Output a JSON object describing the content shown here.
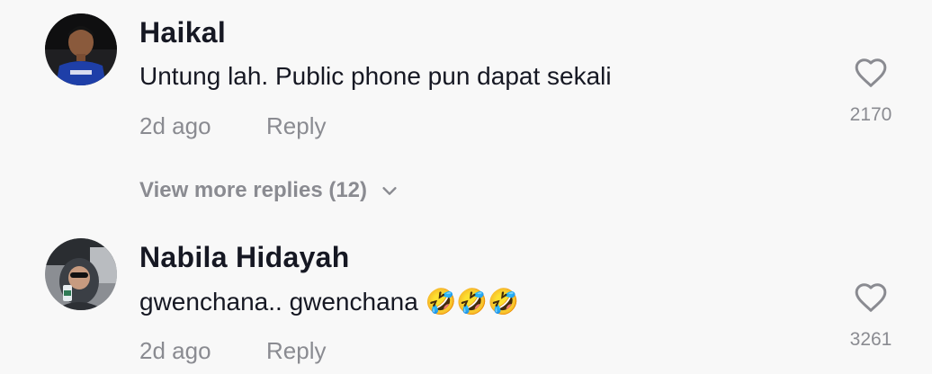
{
  "comments": [
    {
      "username": "Haikal",
      "text": "Untung lah. Public phone pun dapat sekali",
      "time": "2d ago",
      "reply_label": "Reply",
      "likes": "2170",
      "avatar_icon": "user-avatar-photo"
    },
    {
      "username": "Nabila Hidayah",
      "text": "gwenchana.. gwenchana 🤣🤣🤣",
      "time": "2d ago",
      "reply_label": "Reply",
      "likes": "3261",
      "avatar_icon": "user-avatar-photo"
    }
  ],
  "view_more": {
    "label": "View more replies (12)",
    "icon": "chevron-down-icon"
  },
  "colors": {
    "background": "#f8f8f8",
    "primary_text": "#161823",
    "secondary_text": "#8a8b91"
  }
}
